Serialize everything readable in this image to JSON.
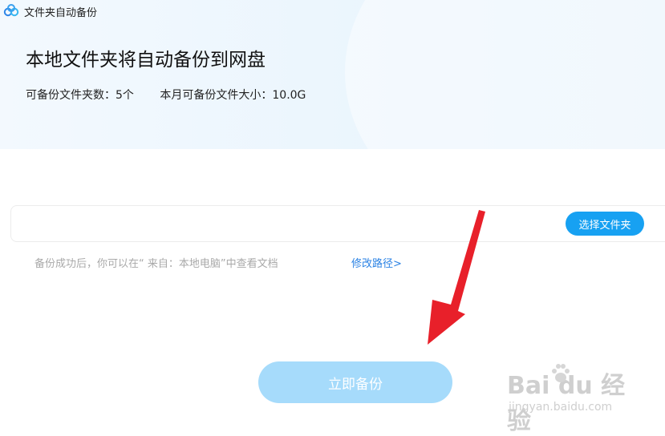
{
  "window": {
    "title": "文件夹自动备份",
    "logo_icon": "baidu-netdisk-cloud-icon"
  },
  "header": {
    "title": "本地文件夹将自动备份到网盘",
    "folder_count": "可备份文件夹数：5个",
    "monthly_size": "本月可备份文件大小：10.0G"
  },
  "path_selector": {
    "value": "",
    "choose_label": "选择文件夹"
  },
  "tip": {
    "text": "备份成功后，你可以在“ 来自：本地电脑”中查看文档",
    "modify_label": "修改路径>"
  },
  "backup_button": {
    "label": "立即备份"
  },
  "watermark": {
    "logo_text": "Bai du 经验",
    "url": "jingyan.baidu.com"
  },
  "colors": {
    "header_bg": "#eaf5fd",
    "accent": "#17a1f2",
    "link": "#2a82e4",
    "backup_button": "#a6dbfb",
    "annotation_arrow": "#e8202a"
  }
}
